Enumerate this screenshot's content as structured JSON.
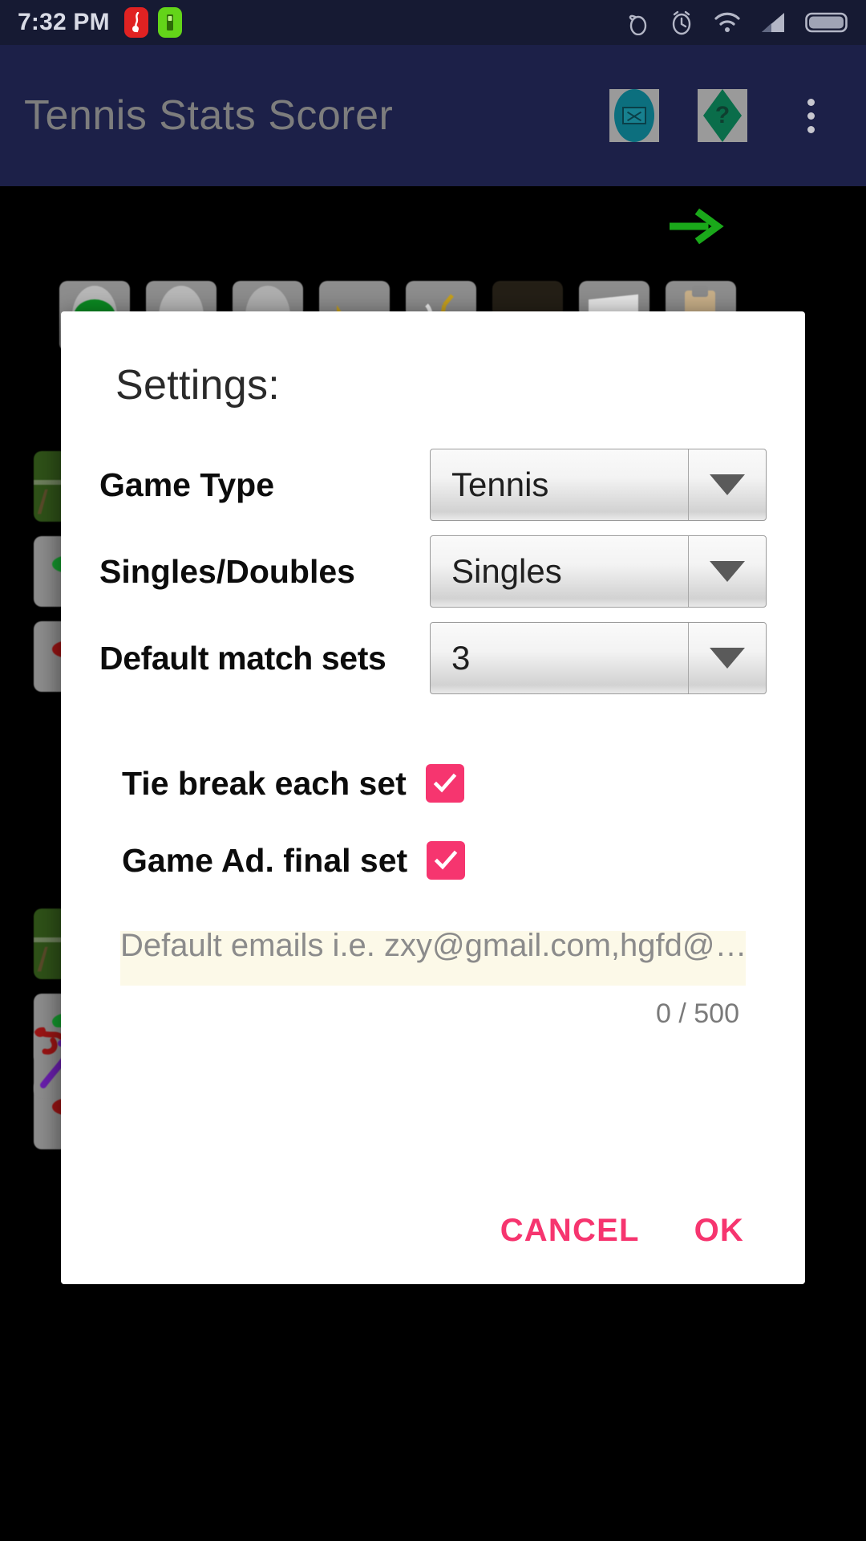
{
  "status_bar": {
    "time": "7:32 PM",
    "left_icons": [
      "music-notification-icon",
      "battery-saver-icon"
    ],
    "right_icons": [
      "screen-record-icon",
      "alarm-icon",
      "wifi-icon",
      "cellular-signal-icon",
      "battery-icon"
    ]
  },
  "app_bar": {
    "title": "Tennis Stats Scorer",
    "actions": [
      {
        "name": "email-icon",
        "label": "Email"
      },
      {
        "name": "help-icon",
        "label": "?"
      },
      {
        "name": "overflow-menu-icon",
        "label": "More options"
      }
    ]
  },
  "background": {
    "next_arrow": "next-arrow-icon",
    "tile_rows": 3
  },
  "dialog": {
    "title": "Settings:",
    "spinner_rows": [
      {
        "label": "Game Type",
        "value": "Tennis",
        "name": "game-type"
      },
      {
        "label": "Singles/Doubles",
        "value": "Singles",
        "name": "singles-doubles"
      },
      {
        "label": "Default match sets",
        "value": "3",
        "name": "default-match-sets"
      }
    ],
    "checkbox_rows": [
      {
        "label": "Tie break each set",
        "checked": true,
        "name": "tie-break-each-set"
      },
      {
        "label": "Game Ad. final set",
        "checked": true,
        "name": "game-ad-final-set"
      }
    ],
    "email_field": {
      "value": "",
      "placeholder": "Default emails i.e. zxy@gmail.com,hgfd@…",
      "counter": "0 / 500"
    },
    "buttons": {
      "cancel": "CANCEL",
      "ok": "OK"
    }
  },
  "colors": {
    "accent_pink": "#f6356f",
    "appbar_bg": "#1c2048",
    "statusbar_bg": "#161a33",
    "email_field_bg": "#fcf9e8",
    "arrow_green": "#1aa81a"
  }
}
